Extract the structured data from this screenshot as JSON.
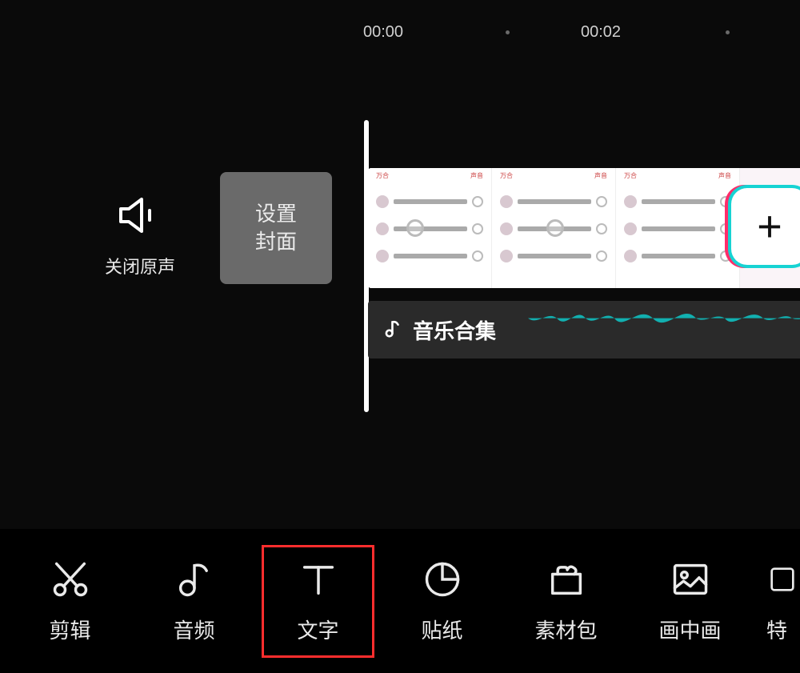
{
  "ruler": {
    "tick1": "00:00",
    "tick2": "00:02"
  },
  "timeline": {
    "mute_label": "关闭原声",
    "cover_line1": "设置",
    "cover_line2": "封面",
    "add_symbol": "+",
    "audio_title": "音乐合集"
  },
  "toolbar": {
    "items": [
      {
        "id": "edit",
        "label": "剪辑",
        "icon": "scissors-icon"
      },
      {
        "id": "audio",
        "label": "音频",
        "icon": "note-icon"
      },
      {
        "id": "text",
        "label": "文字",
        "icon": "text-icon",
        "highlight": true
      },
      {
        "id": "sticker",
        "label": "贴纸",
        "icon": "sticker-icon"
      },
      {
        "id": "material",
        "label": "素材包",
        "icon": "material-icon"
      },
      {
        "id": "pip",
        "label": "画中画",
        "icon": "pip-icon"
      },
      {
        "id": "more",
        "label": "特",
        "icon": "effects-icon"
      }
    ]
  },
  "colors": {
    "accent": "#0fbfbf",
    "highlight": "#ff2d2d"
  }
}
